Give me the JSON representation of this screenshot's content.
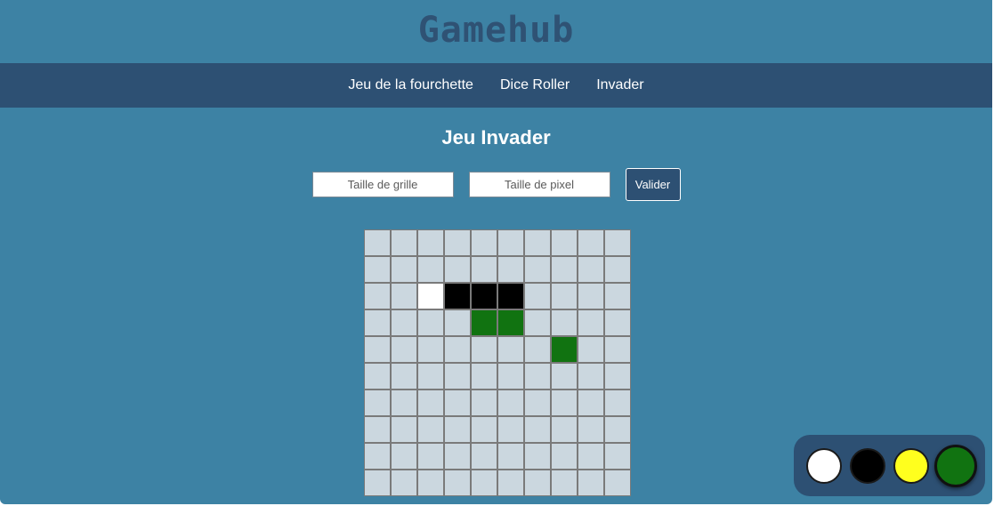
{
  "header": {
    "logo": "Gamehub"
  },
  "nav": {
    "items": [
      {
        "label": "Jeu de la fourchette"
      },
      {
        "label": "Dice Roller"
      },
      {
        "label": "Invader"
      }
    ]
  },
  "main": {
    "title": "Jeu Invader",
    "grid_size_input": {
      "placeholder": "Taille de grille",
      "value": ""
    },
    "pixel_size_input": {
      "placeholder": "Taille de pixel",
      "value": ""
    },
    "validate_label": "Valider"
  },
  "grid": {
    "rows": 10,
    "cols": 10,
    "empty_color": "#cbd7df",
    "painted_cells": [
      {
        "row": 3,
        "col": 3,
        "color": "#ffffff"
      },
      {
        "row": 3,
        "col": 4,
        "color": "#000000"
      },
      {
        "row": 3,
        "col": 5,
        "color": "#000000"
      },
      {
        "row": 3,
        "col": 6,
        "color": "#000000"
      },
      {
        "row": 4,
        "col": 5,
        "color": "#117311"
      },
      {
        "row": 4,
        "col": 6,
        "color": "#117311"
      },
      {
        "row": 5,
        "col": 8,
        "color": "#117311"
      }
    ]
  },
  "palette": {
    "colors": [
      {
        "name": "white",
        "hex": "#ffffff"
      },
      {
        "name": "black",
        "hex": "#000000"
      },
      {
        "name": "yellow",
        "hex": "#ffff1e"
      },
      {
        "name": "green",
        "hex": "#117311"
      }
    ],
    "selected": "green"
  }
}
